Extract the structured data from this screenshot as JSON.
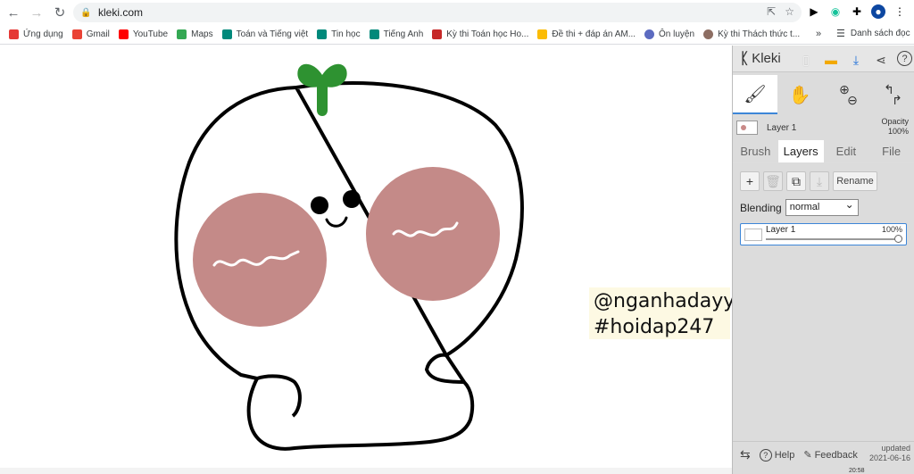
{
  "browser": {
    "url": "kleki.com"
  },
  "bookmarks": [
    {
      "label": "Ứng dụng",
      "color": "#4285f4"
    },
    {
      "label": "Gmail",
      "color": "#ea4335"
    },
    {
      "label": "YouTube",
      "color": "#ff0000"
    },
    {
      "label": "Maps",
      "color": "#34a853"
    },
    {
      "label": "Toán và Tiếng việt",
      "color": "#00897b"
    },
    {
      "label": "Tin học",
      "color": "#00897b"
    },
    {
      "label": "Tiếng Anh",
      "color": "#00897b"
    },
    {
      "label": "Kỳ thi Toán học Ho...",
      "color": "#c62828"
    },
    {
      "label": "Đề thi + đáp án AM...",
      "color": "#fbbc04"
    },
    {
      "label": "Ôn luyện",
      "color": "#5c6bc0"
    },
    {
      "label": "Kỳ thi Thách thức t...",
      "color": "#8d6e63"
    }
  ],
  "bookmarks_more": "»",
  "reading_list": "Danh sách đọc",
  "canvas": {
    "tag_line1": "@nganhadayy",
    "tag_line2": "#hoidap247"
  },
  "kleki": {
    "logo": "Kleki",
    "layer_name": "Layer 1",
    "opacity_label": "Opacity",
    "opacity_value": "100%",
    "tabs": [
      "Brush",
      "Layers",
      "Edit",
      "File"
    ],
    "active_tab": "Layers",
    "rename_label": "Rename",
    "blending_label": "Blending",
    "blending_value": "normal",
    "layers": [
      {
        "name": "Layer 1",
        "opacity": "100%",
        "opacity_fraction": 1.0
      }
    ],
    "help_label": "Help",
    "feedback_label": "Feedback",
    "updated_label": "updated",
    "updated_date": "2021-06-16",
    "accent": "#3d86d8"
  },
  "taskbar_time": "20:58"
}
